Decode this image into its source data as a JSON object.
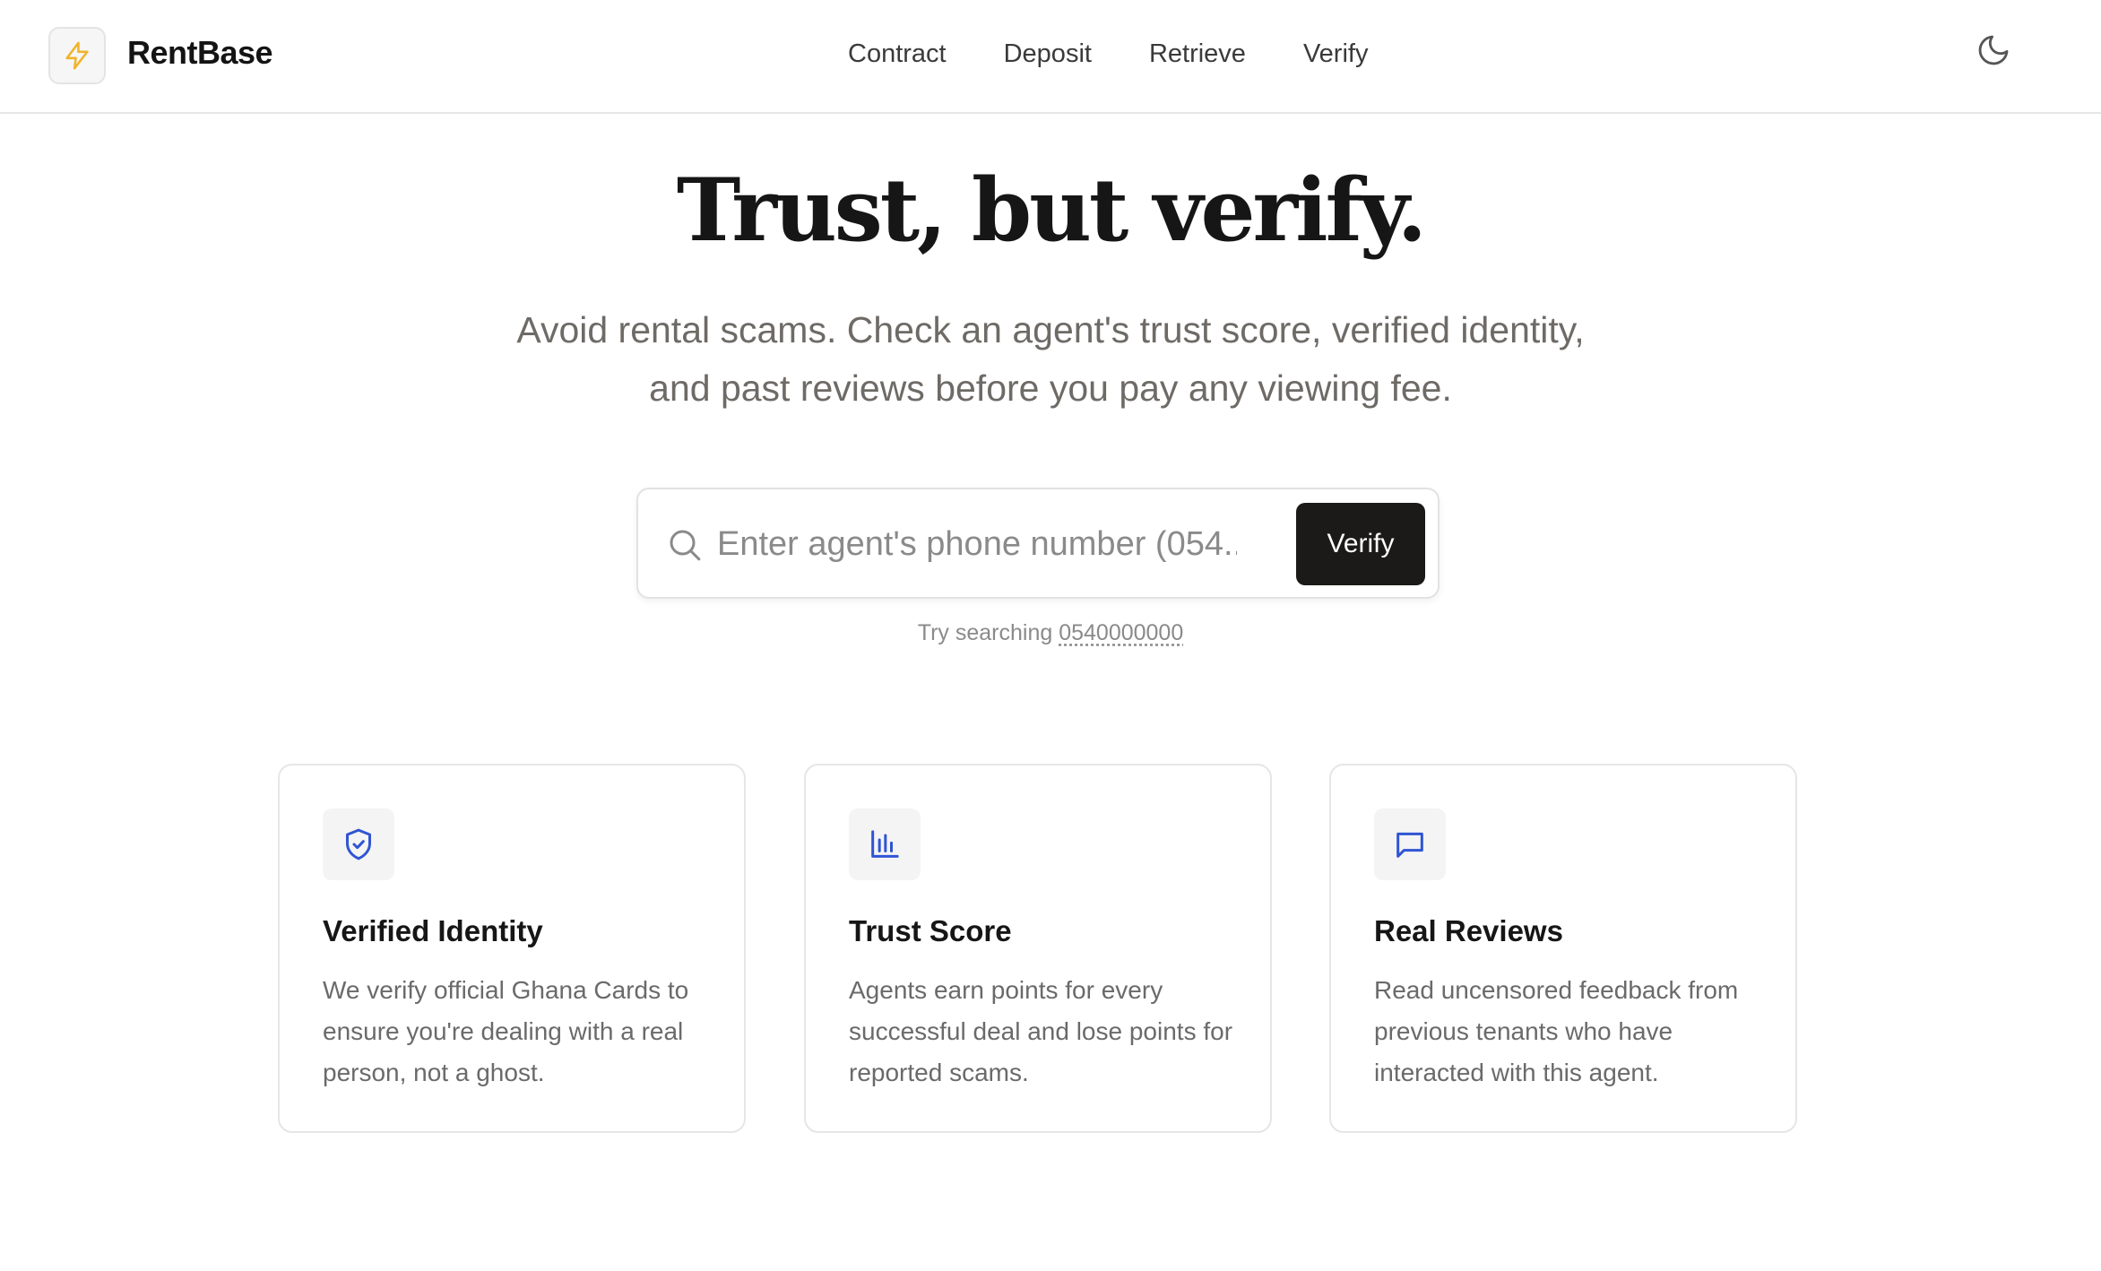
{
  "header": {
    "logo_icon": "lightning-bolt-icon",
    "brand": "RentBase",
    "nav": [
      "Contract",
      "Deposit",
      "Retrieve",
      "Verify"
    ],
    "theme_icon": "moon-icon"
  },
  "hero": {
    "title": "Trust, but verify.",
    "subtitle": "Avoid rental scams. Check an agent's trust score, verified identity, and past reviews before you pay any viewing fee."
  },
  "search": {
    "icon": "search-icon",
    "placeholder": "Enter agent's phone number (054...)",
    "value": "",
    "button_label": "Verify",
    "hint_prefix": "Try searching",
    "hint_sample": "0540000000"
  },
  "features": [
    {
      "icon": "shield-check-icon",
      "title": "Verified Identity",
      "text": "We verify official Ghana Cards to ensure you're dealing with a real person, not a ghost."
    },
    {
      "icon": "bar-chart-icon",
      "title": "Trust Score",
      "text": "Agents earn points for every successful deal and lose points for reported scams."
    },
    {
      "icon": "message-square-icon",
      "title": "Real Reviews",
      "text": "Read uncensored feedback from previous tenants who have interacted with this agent."
    }
  ],
  "colors": {
    "accent_icon": "#2f55d4",
    "logo_bolt": "#f0b429",
    "button_bg": "#1c1a18",
    "subtitle_text": "#6e6a66"
  }
}
